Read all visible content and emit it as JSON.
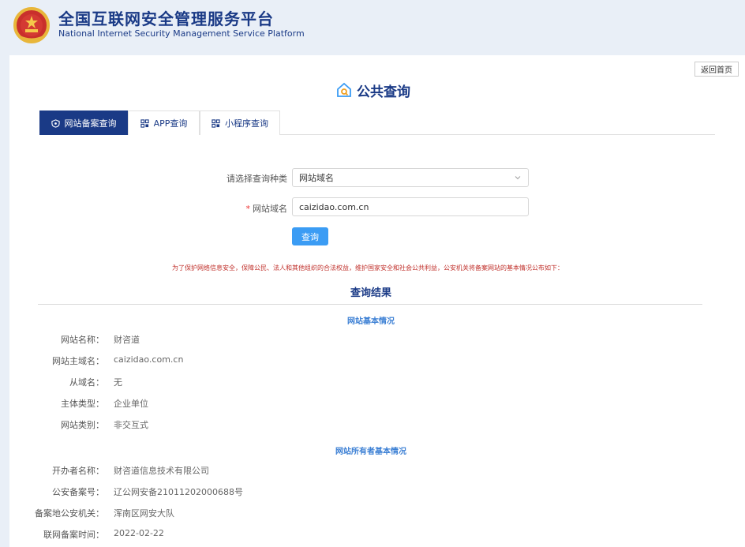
{
  "header": {
    "title": "全国互联网安全管理服务平台",
    "subtitle": "National Internet Security Management Service Platform",
    "emblem_icon": "national-emblem-icon"
  },
  "toolbar": {
    "home_label": "返回首页"
  },
  "page": {
    "title": "公共查询",
    "title_icon": "house-search-icon"
  },
  "tabs": [
    {
      "label": "网站备案查询",
      "icon": "shield-icon",
      "active": true
    },
    {
      "label": "APP查询",
      "icon": "grid-icon",
      "active": false
    },
    {
      "label": "小程序查询",
      "icon": "grid-icon",
      "active": false
    }
  ],
  "form": {
    "type_label": "请选择查询种类",
    "type_value": "网站域名",
    "domain_label": "网站域名",
    "domain_required_mark": "*",
    "domain_value": "caizidao.com.cn",
    "search_label": "查询"
  },
  "notice": "为了保护网络信息安全，保障公民、法人和其他组织的合法权益，维护国家安全和社会公共利益，公安机关将备案网站的基本情况公布如下：",
  "results": {
    "title": "查询结果",
    "basic": {
      "title": "网站基本情况",
      "rows": [
        {
          "label": "网站名称：",
          "value": "财咨道"
        },
        {
          "label": "网站主域名：",
          "value": "caizidao.com.cn"
        },
        {
          "label": "从域名：",
          "value": "无"
        },
        {
          "label": "主体类型：",
          "value": "企业单位"
        },
        {
          "label": "网站类别：",
          "value": "非交互式"
        }
      ]
    },
    "owner": {
      "title": "网站所有者基本情况",
      "rows": [
        {
          "label": "开办者名称：",
          "value": "财咨道信息技术有限公司"
        },
        {
          "label": "公安备案号：",
          "value": "辽公网安备21011202000688号"
        },
        {
          "label": "备案地公安机关：",
          "value": "浑南区网安大队"
        },
        {
          "label": "联网备案时间：",
          "value": "2022-02-22"
        }
      ]
    }
  },
  "colors": {
    "brand": "#1a3a86",
    "accent": "#3b9cf4",
    "notice": "#c0302b",
    "background": "#e9eff7"
  }
}
